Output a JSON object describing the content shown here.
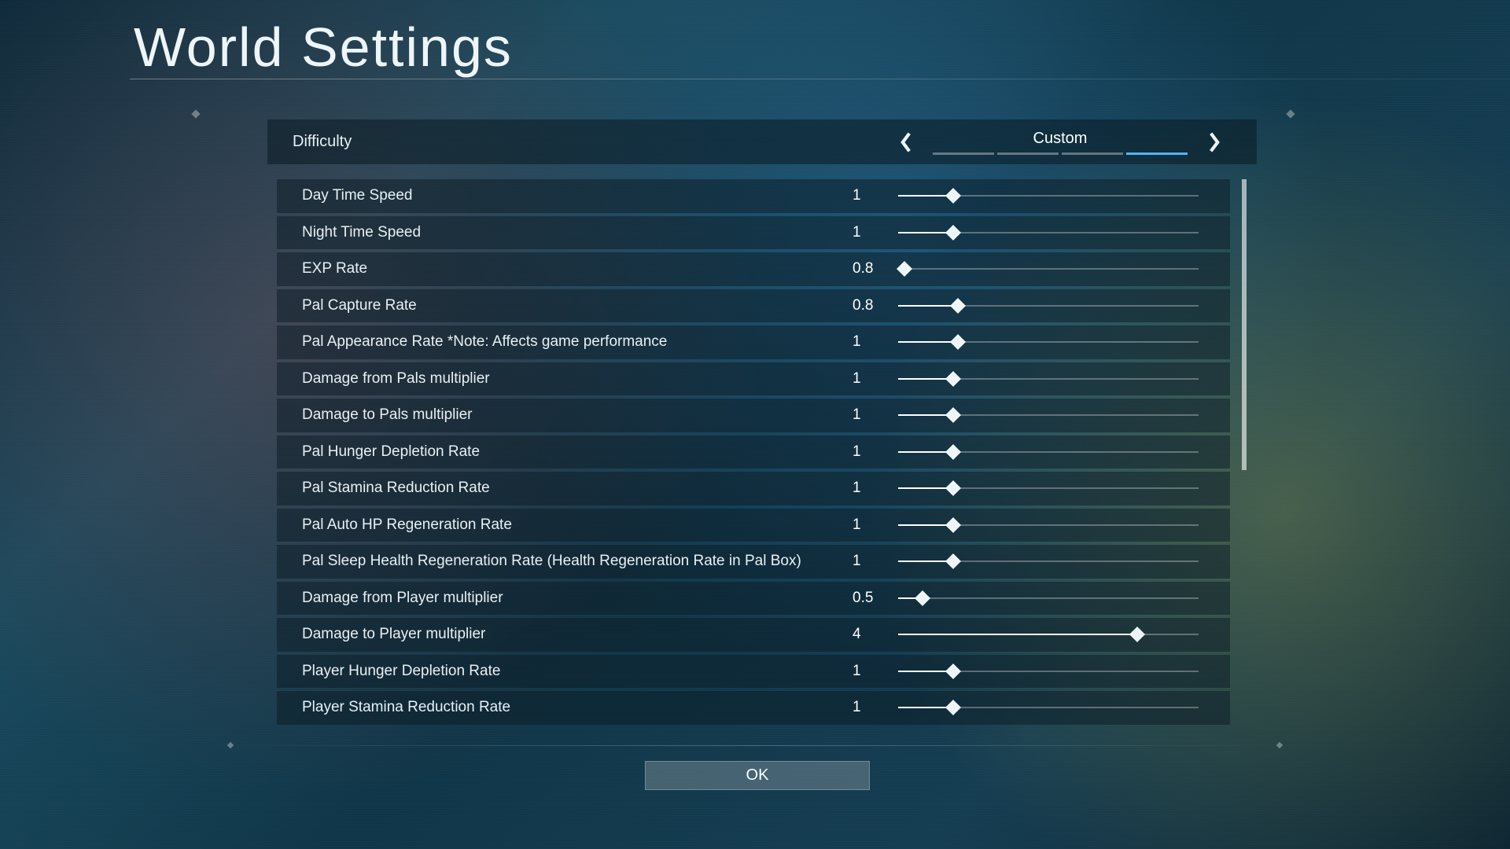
{
  "title": "World Settings",
  "difficulty": {
    "label": "Difficulty",
    "value": "Custom",
    "tick_count": 4,
    "active_tick": 3
  },
  "slider_range": {
    "min": 0.1,
    "max": 5.0
  },
  "settings": [
    {
      "label": "Day Time Speed",
      "value": 1,
      "pos": 0.184,
      "display": "1"
    },
    {
      "label": "Night Time Speed",
      "value": 1,
      "pos": 0.184,
      "display": "1"
    },
    {
      "label": "EXP Rate",
      "value": 0.8,
      "pos": 0.02,
      "display": "0.8"
    },
    {
      "label": "Pal Capture Rate",
      "value": 0.8,
      "pos": 0.2,
      "display": "0.8"
    },
    {
      "label": "Pal Appearance Rate *Note: Affects game performance",
      "value": 1,
      "pos": 0.2,
      "display": "1"
    },
    {
      "label": "Damage from Pals multiplier",
      "value": 1,
      "pos": 0.184,
      "display": "1"
    },
    {
      "label": "Damage to Pals multiplier",
      "value": 1,
      "pos": 0.184,
      "display": "1"
    },
    {
      "label": "Pal Hunger Depletion Rate",
      "value": 1,
      "pos": 0.184,
      "display": "1"
    },
    {
      "label": "Pal Stamina Reduction Rate",
      "value": 1,
      "pos": 0.184,
      "display": "1"
    },
    {
      "label": "Pal Auto HP Regeneration Rate",
      "value": 1,
      "pos": 0.184,
      "display": "1"
    },
    {
      "label": "Pal Sleep Health Regeneration Rate (Health Regeneration Rate in Pal Box)",
      "value": 1,
      "pos": 0.184,
      "display": "1"
    },
    {
      "label": "Damage from Player multiplier",
      "value": 0.5,
      "pos": 0.082,
      "display": "0.5"
    },
    {
      "label": "Damage to Player multiplier",
      "value": 4,
      "pos": 0.796,
      "display": "4"
    },
    {
      "label": "Player Hunger Depletion Rate",
      "value": 1,
      "pos": 0.184,
      "display": "1"
    },
    {
      "label": "Player Stamina Reduction Rate",
      "value": 1,
      "pos": 0.184,
      "display": "1"
    }
  ],
  "ok_label": "OK"
}
